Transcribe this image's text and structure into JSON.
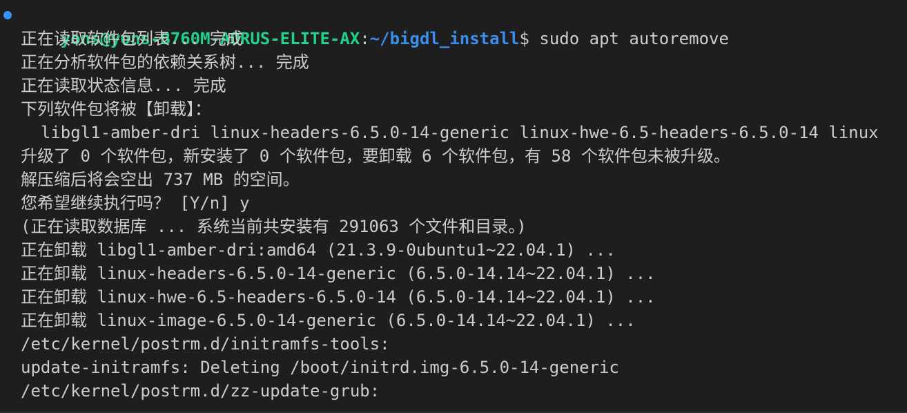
{
  "colors": {
    "background": "#1e1e1e",
    "foreground": "#cccccc",
    "user_host": "#23d18b",
    "path": "#3b8eea",
    "prompt_dot": "#3794ff"
  },
  "prompt": {
    "user_host": "yons@yons-B760M-AORUS-ELITE-AX",
    "colon": ":",
    "path": "~/bigdl_install",
    "dollar": "$",
    "command": " sudo apt autoremove"
  },
  "lines": [
    "正在读取软件包列表... 完成",
    "正在分析软件包的依赖关系树... 完成",
    "正在读取状态信息... 完成",
    "下列软件包将被【卸载】：",
    "  libgl1-amber-dri linux-headers-6.5.0-14-generic linux-hwe-6.5-headers-6.5.0-14 linux",
    "升级了 0 个软件包，新安装了 0 个软件包，要卸载 6 个软件包，有 58 个软件包未被升级。",
    "解压缩后将会空出 737 MB 的空间。",
    "您希望继续执行吗？ [Y/n] y",
    "(正在读取数据库 ... 系统当前共安装有 291063 个文件和目录。)",
    "正在卸载 libgl1-amber-dri:amd64 (21.3.9-0ubuntu1~22.04.1) ...",
    "正在卸载 linux-headers-6.5.0-14-generic (6.5.0-14.14~22.04.1) ...",
    "正在卸载 linux-hwe-6.5-headers-6.5.0-14 (6.5.0-14.14~22.04.1) ...",
    "正在卸载 linux-image-6.5.0-14-generic (6.5.0-14.14~22.04.1) ...",
    "/etc/kernel/postrm.d/initramfs-tools:",
    "update-initramfs: Deleting /boot/initrd.img-6.5.0-14-generic",
    "/etc/kernel/postrm.d/zz-update-grub:"
  ]
}
